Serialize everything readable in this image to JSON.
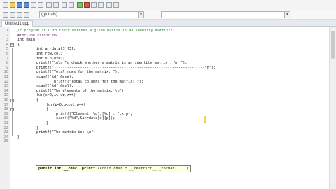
{
  "toolbar": {
    "scope_combo": "(globals)",
    "function_combo": ""
  },
  "tab": {
    "file_name": "Untitled1.cpp"
  },
  "code_lines": [
    {
      "n": "1",
      "text": "/* program in C to check whether a given matrix is an identity matrix*/",
      "cls": "comment",
      "indent": 0
    },
    {
      "n": "2",
      "text": "#include <stdio.h>",
      "cls": "directive",
      "indent": 0
    },
    {
      "n": "3",
      "text": "int main()",
      "cls": "",
      "indent": 0
    },
    {
      "n": "4",
      "text": "{",
      "cls": "",
      "indent": 0
    },
    {
      "n": "5",
      "text": "int arrdata[3][3];",
      "cls": "",
      "indent": 1
    },
    {
      "n": "6",
      "text": "int row,col;",
      "cls": "",
      "indent": 1
    },
    {
      "n": "7",
      "text": "int x,p,hx=1;",
      "cls": "",
      "indent": 1
    },
    {
      "n": "8",
      "text": "printf(\"\\n\\n To check whether a matrix is an identity matrix : \\n \");",
      "cls": "",
      "indent": 1
    },
    {
      "n": "9",
      "text": "printf(\"---------------------------------------------------------------------\\n\");",
      "cls": "",
      "indent": 1
    },
    {
      "n": "10",
      "text": "printf(\"Total rows for the matrix: \");",
      "cls": "",
      "indent": 1
    },
    {
      "n": "11",
      "text": "scanf(\"%d\",&row);",
      "cls": "",
      "indent": 1
    },
    {
      "n": "12",
      "text": "        printf(\"Total columns for the matrix: \");",
      "cls": "",
      "indent": 1
    },
    {
      "n": "13",
      "text": "scanf(\"%d\",&col);",
      "cls": "",
      "indent": 1
    },
    {
      "n": "14",
      "text": "printf(\"The elements of the matrix: \\n\");",
      "cls": "",
      "indent": 1
    },
    {
      "n": "15",
      "text": "for(x=0;x<row;x++)",
      "cls": "",
      "indent": 1
    },
    {
      "n": "16",
      "text": "{",
      "cls": "",
      "indent": 1
    },
    {
      "n": "17",
      "text": "for(p=0;p<col;p++)",
      "cls": "",
      "indent": 2
    },
    {
      "n": "18",
      "text": "{",
      "cls": "",
      "indent": 2
    },
    {
      "n": "19",
      "text": "printf(\"Element [%d],[%d] : \",x,p);",
      "cls": "",
      "indent": 3
    },
    {
      "n": "20",
      "text": "scanf(\"%d\",&arrdata[x][p]);",
      "cls": "",
      "indent": 3
    },
    {
      "n": "21",
      "text": "}",
      "cls": "",
      "indent": 2
    },
    {
      "n": "22",
      "text": "}",
      "cls": "",
      "indent": 1
    },
    {
      "n": "23",
      "text": "printf(\"The matrix is: \\n\")",
      "cls": "",
      "indent": 1
    },
    {
      "n": "24",
      "text": "}",
      "cls": "",
      "indent": 0
    },
    {
      "n": "25",
      "text": "",
      "cls": "",
      "indent": 0
    }
  ],
  "tooltip": {
    "bold_part": "public int __cdecl printf",
    "rest": " (const char * __restrict__ _Format, ...)"
  }
}
